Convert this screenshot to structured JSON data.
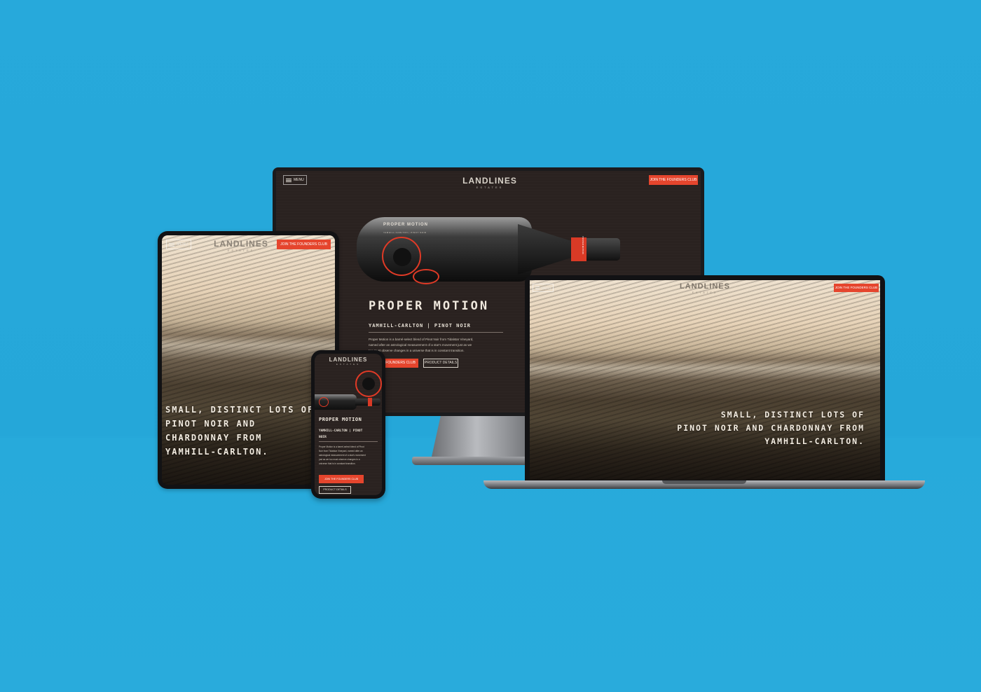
{
  "brand": {
    "name": "LANDLINES",
    "sub": "ESTATES"
  },
  "nav": {
    "menu_label": "MENU",
    "cta_label": "JOIN THE FOUNDERS CLUB"
  },
  "hero": {
    "headline_lines": [
      "SMALL, DISTINCT LOTS OF",
      "PINOT NOIR AND CHARDONNAY FROM",
      "YAMHILL-CARLTON."
    ]
  },
  "tablet_hero": {
    "lines": [
      "SMALL, DISTINCT LOTS OF",
      "PINOT NOIR AND",
      "CHARDONNAY FROM",
      "YAMHILL-CARLTON."
    ]
  },
  "product": {
    "label_title": "PROPER MOTION",
    "label_sub": "YAMHILL-CARLTON | PINOT NOIR",
    "title": "PROPER MOTION",
    "subtitle": "YAMHILL-CARLTON | PINOT NOIR",
    "phone_subtitle_lines": [
      "YAMHILL-CARLTON | PINOT",
      "NOIR"
    ],
    "description_lines": [
      "Proper Motion is a barrel-select blend of Pinot Noir from Tidalstar Vineyard,",
      "named after an astrological measurement of a star's movement just as we",
      "too must observe changes in a universe that is in constant transition."
    ],
    "phone_description_lines": [
      "Proper Motion is a barrel-select blend of Pinot",
      "Noir from Tidalstar Vineyard, named after an",
      "astrological measurement of a star's movement",
      "just as we too must observe changes in a",
      "universe that is in constant transition."
    ],
    "join_label_cropped": "E FOUNDERS CLUB",
    "details_label": "PRODUCT DETAILS",
    "foil_text": "PROPER MOTION"
  },
  "colors": {
    "background": "#27a9db",
    "accent": "#e5452d",
    "screen_dark": "#2b2321"
  }
}
